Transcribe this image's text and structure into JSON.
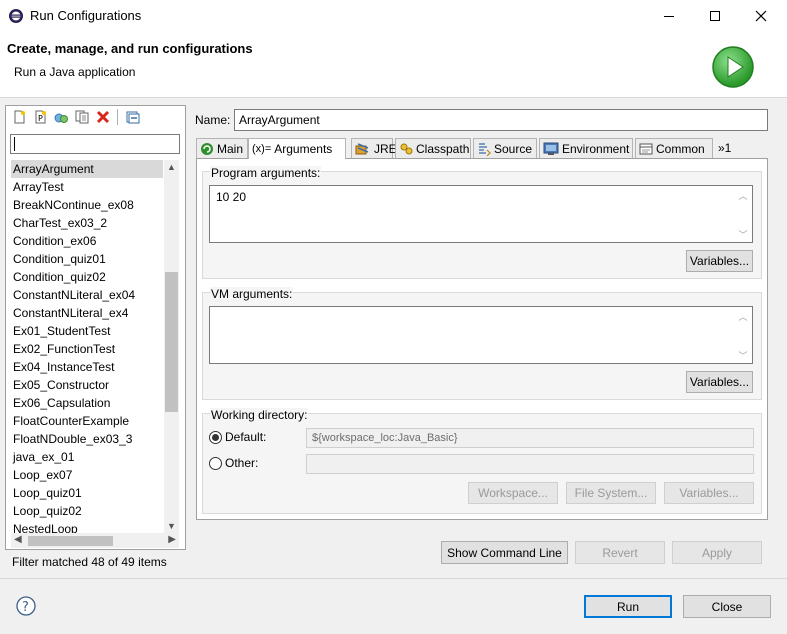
{
  "window": {
    "title": "Run Configurations",
    "minimize_glyph": "—",
    "maximize_glyph": "☐",
    "close_glyph": "✕"
  },
  "header": {
    "title": "Create, manage, and run configurations",
    "subtitle": "Run a Java application",
    "icon": "run-icon",
    "icon_color": "#3aa53a"
  },
  "left": {
    "toolbar_icons": [
      "new-config-icon",
      "new-prototype-icon",
      "export-icon",
      "duplicate-icon",
      "delete-icon",
      "collapse-all-icon"
    ],
    "filter_value": "",
    "items": [
      "ArrayArgument",
      "ArrayTest",
      "BreakNContinue_ex08",
      "CharTest_ex03_2",
      "Condition_ex06",
      "Condition_quiz01",
      "Condition_quiz02",
      "ConstantNLiteral_ex04",
      "ConstantNLiteral_ex4",
      "Ex01_StudentTest",
      "Ex02_FunctionTest",
      "Ex04_InstanceTest",
      "Ex05_Constructor",
      "Ex06_Capsulation",
      "FloatCounterExample",
      "FloatNDouble_ex03_3",
      "java_ex_01",
      "Loop_ex07",
      "Loop_quiz01",
      "Loop_quiz02",
      "NestedLoop"
    ],
    "selected_index": 0,
    "status": "Filter matched 48 of 49 items"
  },
  "config": {
    "name_label": "Name:",
    "name_value": "ArrayArgument",
    "tabs": [
      {
        "label": "Main",
        "icon": "main-tab-icon"
      },
      {
        "label": "Arguments",
        "icon": "arguments-tab-icon",
        "prefix": "(x)="
      },
      {
        "label": "JRE",
        "icon": "jre-tab-icon"
      },
      {
        "label": "Classpath",
        "icon": "classpath-tab-icon"
      },
      {
        "label": "Source",
        "icon": "source-tab-icon"
      },
      {
        "label": "Environment",
        "icon": "environment-tab-icon"
      },
      {
        "label": "Common",
        "icon": "common-tab-icon"
      },
      {
        "label": "»1",
        "icon": "more-tabs-icon"
      }
    ],
    "active_tab": 1,
    "program_args": {
      "label": "Program arguments:",
      "value": "10 20",
      "variables_button": "Variables..."
    },
    "vm_args": {
      "label": "VM arguments:",
      "value": "",
      "variables_button": "Variables..."
    },
    "working_dir": {
      "label": "Working directory:",
      "default_label": "Default:",
      "default_value": "${workspace_loc:Java_Basic}",
      "other_label": "Other:",
      "other_value": "",
      "selected": "default",
      "workspace_button": "Workspace...",
      "filesystem_button": "File System...",
      "variables_button": "Variables..."
    }
  },
  "bottom": {
    "show_command_line": "Show Command Line",
    "revert": "Revert",
    "apply": "Apply",
    "run": "Run",
    "close": "Close"
  },
  "colors": {
    "accent": "#0078d7",
    "selection": "#d9d9d9",
    "delete": "#d9261c"
  }
}
